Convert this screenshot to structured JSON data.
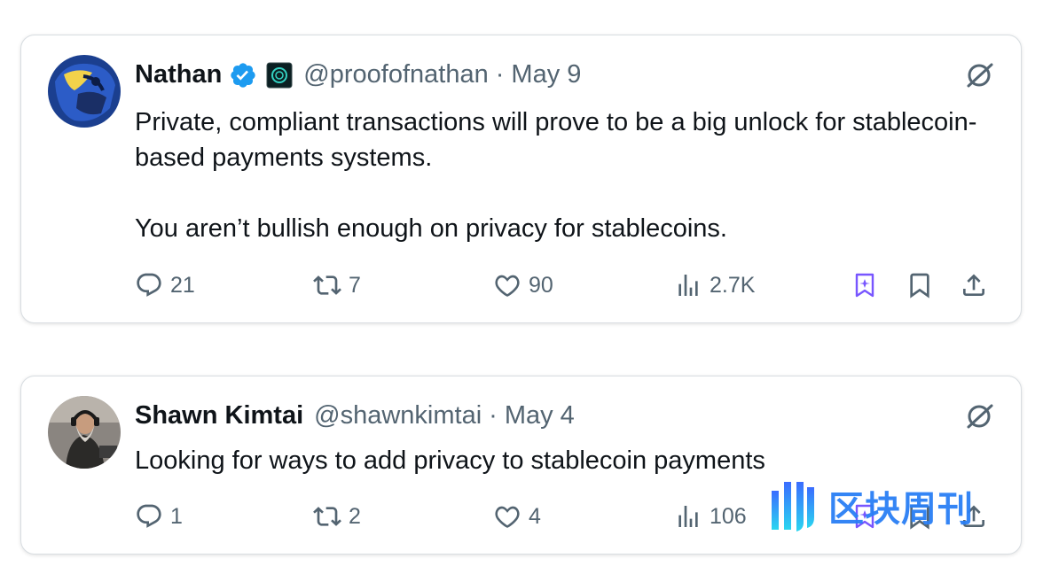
{
  "tweets": [
    {
      "name": "Nathan",
      "handle": "@proofofnathan",
      "separator": "·",
      "date": "May 9",
      "verified": true,
      "paragraphs": [
        "Private, compliant transactions will prove to be a big unlock for stablecoin-based payments systems.",
        "You aren’t bullish enough on privacy for stablecoins."
      ],
      "stats": {
        "replies": "21",
        "reposts": "7",
        "likes": "90",
        "views": "2.7K"
      }
    },
    {
      "name": "Shawn Kimtai",
      "handle": "@shawnkimtai",
      "separator": "·",
      "date": "May 4",
      "verified": false,
      "paragraphs": [
        "Looking for ways to add privacy to stablecoin payments"
      ],
      "stats": {
        "replies": "1",
        "reposts": "2",
        "likes": "4",
        "views": "106"
      }
    }
  ],
  "watermark": {
    "text": "区块周刊"
  },
  "colors": {
    "text": "#0f1419",
    "secondary": "#536471",
    "verified": "#1d9bf0",
    "grok_bookmark": "#7856ff",
    "watermark": "#2a7ff5"
  },
  "icons": [
    "reply-icon",
    "repost-icon",
    "like-icon",
    "views-icon",
    "grok-bookmark-icon",
    "bookmark-icon",
    "share-icon",
    "grok-icon",
    "verified-badge-icon"
  ]
}
